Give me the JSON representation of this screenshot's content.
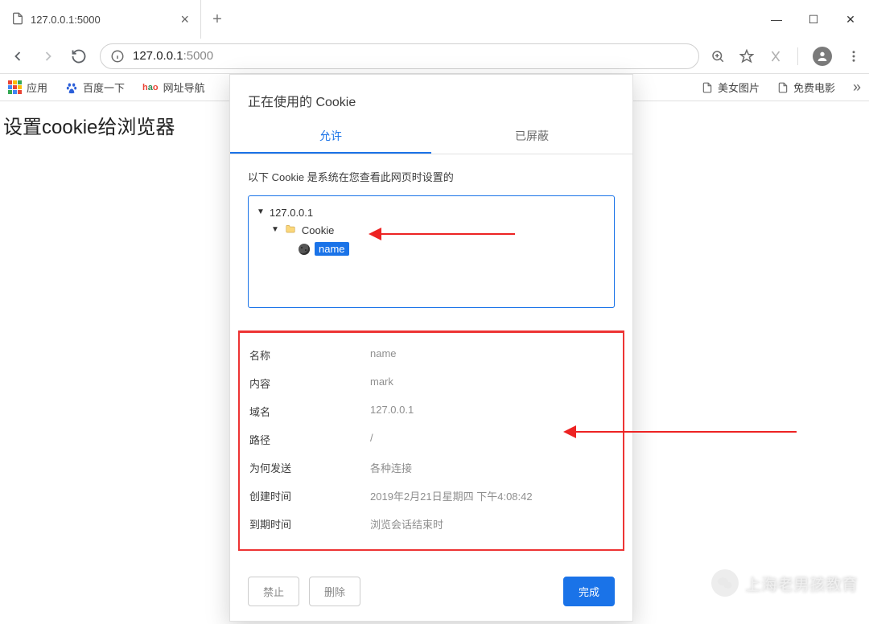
{
  "window": {
    "minimize": "—",
    "maximize": "☐",
    "close": "✕"
  },
  "tab": {
    "title": "127.0.0.1:5000"
  },
  "url": {
    "host": "127.0.0.1",
    "port": ":5000"
  },
  "bookmarks": {
    "apps": "应用",
    "baidu": "百度一下",
    "hao": "网址导航",
    "bm1": "美女图片",
    "bm2": "免费电影",
    "chevron": "»"
  },
  "page": {
    "heading": "设置cookie给浏览器"
  },
  "dialog": {
    "title": "正在使用的 Cookie",
    "tab_allowed": "允许",
    "tab_blocked": "已屏蔽",
    "desc": "以下 Cookie 是系统在您查看此网页时设置的",
    "tree": {
      "host": "127.0.0.1",
      "folder": "Cookie",
      "item": "name"
    },
    "details": [
      {
        "label": "名称",
        "value": "name"
      },
      {
        "label": "内容",
        "value": "mark"
      },
      {
        "label": "域名",
        "value": "127.0.0.1"
      },
      {
        "label": "路径",
        "value": "/"
      },
      {
        "label": "为何发送",
        "value": "各种连接"
      },
      {
        "label": "创建时间",
        "value": "2019年2月21日星期四 下午4:08:42"
      },
      {
        "label": "到期时间",
        "value": "浏览会话结束时"
      }
    ],
    "actions": {
      "block": "禁止",
      "delete": "删除",
      "done": "完成"
    }
  },
  "watermark": "上海老男孩教育"
}
